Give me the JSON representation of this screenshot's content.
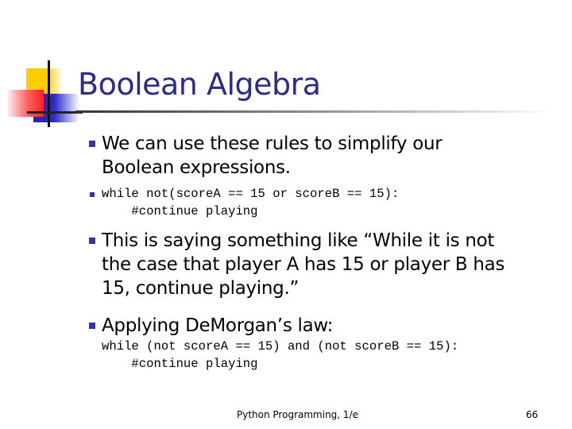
{
  "slide": {
    "title": "Boolean Algebra",
    "bullets": [
      {
        "type": "text",
        "lines": [
          "We can use these rules to simplify our",
          "Boolean expressions."
        ]
      },
      {
        "type": "code",
        "lines": [
          "while not(scoreA == 15 or scoreB == 15):",
          "    #continue playing"
        ]
      },
      {
        "type": "text",
        "lines": [
          "This is saying something like “While it is not",
          "the case that player A has 15 or player B has",
          "15, continue playing.”"
        ]
      },
      {
        "type": "text",
        "lines": [
          "Applying DeMorgan’s law:"
        ]
      }
    ],
    "code_block": {
      "lines": [
        "while (not scoreA == 15) and (not scoreB == 15):",
        "    #continue playing"
      ]
    },
    "footer": {
      "text": "Python Programming, 1/e",
      "page_number": "66"
    },
    "colors": {
      "title": "#2b2b8a",
      "bullet": "#3333aa",
      "logo_yellow": "#ffcc00",
      "logo_blue": "#2a2acc",
      "logo_red": "#ff2020"
    }
  }
}
